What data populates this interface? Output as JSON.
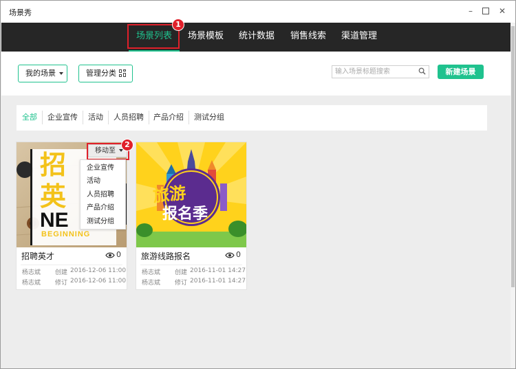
{
  "window": {
    "title": "场景秀"
  },
  "nav": {
    "tabs": [
      {
        "label": "场景列表",
        "active": true
      },
      {
        "label": "场景模板"
      },
      {
        "label": "统计数据"
      },
      {
        "label": "销售线索"
      },
      {
        "label": "渠道管理"
      }
    ]
  },
  "annotations": {
    "badge1": "1",
    "badge2": "2"
  },
  "toolbar": {
    "my_scenes": "我的场景",
    "manage_categories": "管理分类",
    "search_placeholder": "输入场景标题搜索",
    "new_scene": "新建场景"
  },
  "filters": [
    "全部",
    "企业宣传",
    "活动",
    "人员招聘",
    "产品介绍",
    "测试分组"
  ],
  "cards": [
    {
      "title": "招聘英才",
      "views": "0",
      "author": "杨志斌",
      "created_label": "创建",
      "created": "2016-12-06 11:00",
      "modified_label": "修订",
      "modified": "2016-12-06 11:00",
      "thumb_text": {
        "line1": "招",
        "line2": "英",
        "line3": "NE",
        "line4": "BEGINNING"
      }
    },
    {
      "title": "旅游线路报名",
      "views": "0",
      "author": "杨志斌",
      "created_label": "创建",
      "created": "2016-11-01 14:27",
      "modified_label": "修订",
      "modified": "2016-11-01 14:27",
      "thumb_text": {
        "line1": "旅游",
        "line2": "报名季"
      }
    }
  ],
  "move_menu": {
    "button": "移动至",
    "items": [
      "企业宣传",
      "活动",
      "人员招聘",
      "产品介绍",
      "测试分组"
    ]
  },
  "colors": {
    "accent": "#1fc28e",
    "navbar": "#262626",
    "highlight": "#e0202a"
  }
}
